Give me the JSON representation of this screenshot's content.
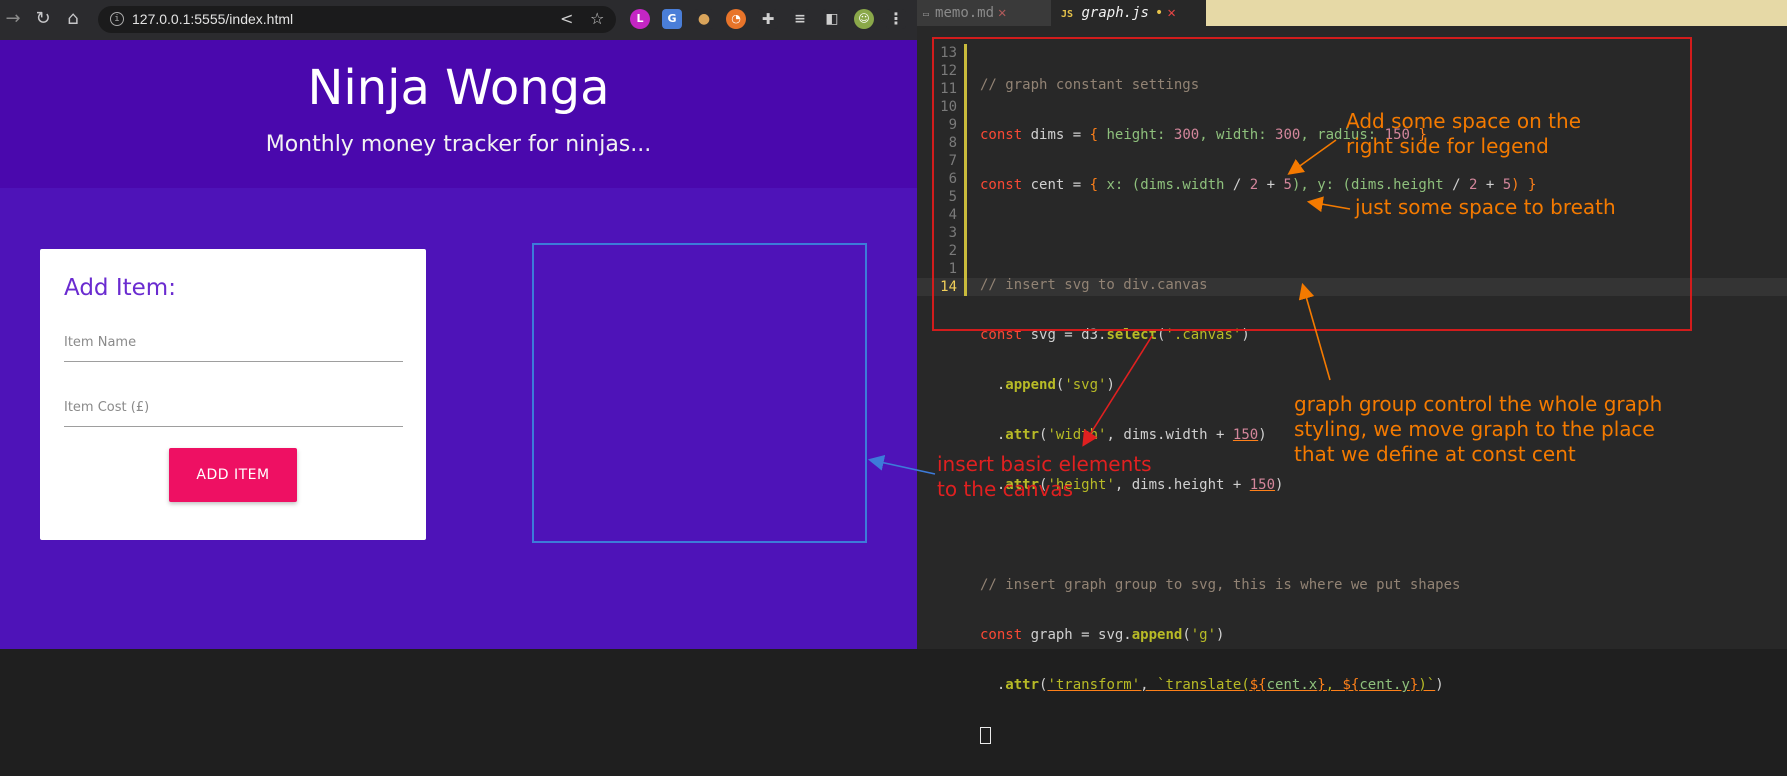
{
  "browser": {
    "url": "127.0.0.1:5555/index.html",
    "icons": [
      "back-icon",
      "reload-icon",
      "home-icon",
      "info-icon",
      "share-icon",
      "star-icon",
      "extensions-icon",
      "reading-list-icon",
      "side-panel-icon",
      "profile-icon",
      "menu-icon"
    ],
    "page": {
      "title": "Ninja Wonga",
      "subtitle": "Monthly money tracker for ninjas...",
      "form": {
        "heading": "Add Item:",
        "name_placeholder": "Item Name",
        "cost_placeholder": "Item Cost (£)",
        "button": "ADD ITEM"
      }
    }
  },
  "editor": {
    "tabs": [
      {
        "label": "memo.md",
        "active": false
      },
      {
        "label": "graph.js",
        "active": true,
        "modified": true
      }
    ],
    "line_numbers": [
      "13",
      "12",
      "11",
      "10",
      "9",
      "8",
      "7",
      "6",
      "5",
      "4",
      "3",
      "2",
      "1",
      "14"
    ],
    "code": {
      "l13": "// graph constant settings",
      "l12_kw": "const",
      "l12_a": " dims = ",
      "l12_b": "{",
      "l12_c": " height: ",
      "l12_d": "300",
      "l12_e": ", width: ",
      "l12_f": "300",
      "l12_g": ", radius: ",
      "l12_h": "150",
      "l12_i": " }",
      "l11_kw": "const",
      "l11_a": " cent = ",
      "l11_b": "{",
      "l11_c": " x: (",
      "l11_d": "dims.width",
      "l11_e": " / ",
      "l11_f": "2",
      "l11_g": " + ",
      "l11_h": "5",
      "l11_i": "), y: (",
      "l11_j": "dims.height",
      "l11_k": " / ",
      "l11_l": "2",
      "l11_m": " + ",
      "l11_n": "5",
      "l11_o": ") }",
      "l9": "// insert svg to div.canvas",
      "l8_kw": "const",
      "l8_a": " svg = d3.",
      "l8_fn": "select",
      "l8_b": "(",
      "l8_st": "'.canvas'",
      "l8_c": ")",
      "l7_a": "  .",
      "l7_fn": "append",
      "l7_b": "(",
      "l7_st": "'svg'",
      "l7_c": ")",
      "l6_a": "  .",
      "l6_fn": "attr",
      "l6_b": "(",
      "l6_st": "'width'",
      "l6_c": ", dims.width + ",
      "l6_nm": "150",
      "l6_d": ")",
      "l5_a": "  .",
      "l5_fn": "attr",
      "l5_b": "(",
      "l5_st": "'height'",
      "l5_c": ", dims.height + ",
      "l5_nm": "150",
      "l5_d": ")",
      "l3": "// insert graph group to svg, this is where we put shapes",
      "l2_kw": "const",
      "l2_a": " graph = svg.",
      "l2_fn": "append",
      "l2_b": "(",
      "l2_st": "'g'",
      "l2_c": ")",
      "l1_a": "  .",
      "l1_fn": "attr",
      "l1_b": "(",
      "l1_st": "'transform'",
      "l1_c": ", ",
      "l1_d": "`translate(",
      "l1_e": "${",
      "l1_f": "cent.x",
      "l1_g": "}",
      "l1_h": ", ",
      "l1_i": "${",
      "l1_j": "cent.y",
      "l1_k": "}",
      "l1_l": ")`",
      "l1_m": ")"
    },
    "annotations": {
      "legend_space": "Add some space on the\nright side for legend",
      "breath_space": "just some space to breath",
      "graph_group": "graph group control the whole graph\nstyling, we move graph to the place\nthat we define at const cent",
      "insert_basic": "insert basic elements\nto the canvas"
    },
    "colors": {
      "orange_note": "#f47a00",
      "red_note": "#e02020",
      "red_frame": "#d21c1c",
      "blue_arrow": "#3d7bd9"
    }
  }
}
